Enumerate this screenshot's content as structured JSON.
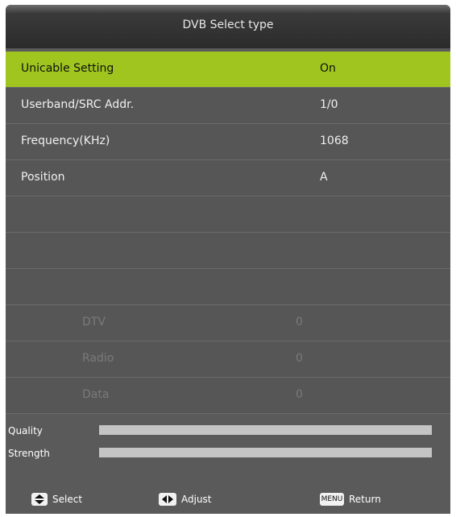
{
  "dialog": {
    "title": "DVB Select type"
  },
  "settings": [
    {
      "label": "Unicable Setting",
      "value": "On"
    },
    {
      "label": "Userband/SRC Addr.",
      "value": "1/0"
    },
    {
      "label": "Frequency(KHz)",
      "value": "1068"
    },
    {
      "label": "Position",
      "value": "A"
    }
  ],
  "scan_results": [
    {
      "label": "DTV",
      "value": "0"
    },
    {
      "label": "Radio",
      "value": "0"
    },
    {
      "label": "Data",
      "value": "0"
    }
  ],
  "signal": {
    "quality_label": "Quality",
    "quality_level": 1.0,
    "strength_label": "Strength",
    "strength_level": 1.0
  },
  "footer": {
    "select_label": "Select",
    "adjust_label": "Adjust",
    "menu_key": "MENU",
    "return_label": "Return"
  },
  "colors": {
    "highlight": "#9fc51e",
    "panel": "#5a5a5a",
    "bar": "#c4c4c4"
  }
}
